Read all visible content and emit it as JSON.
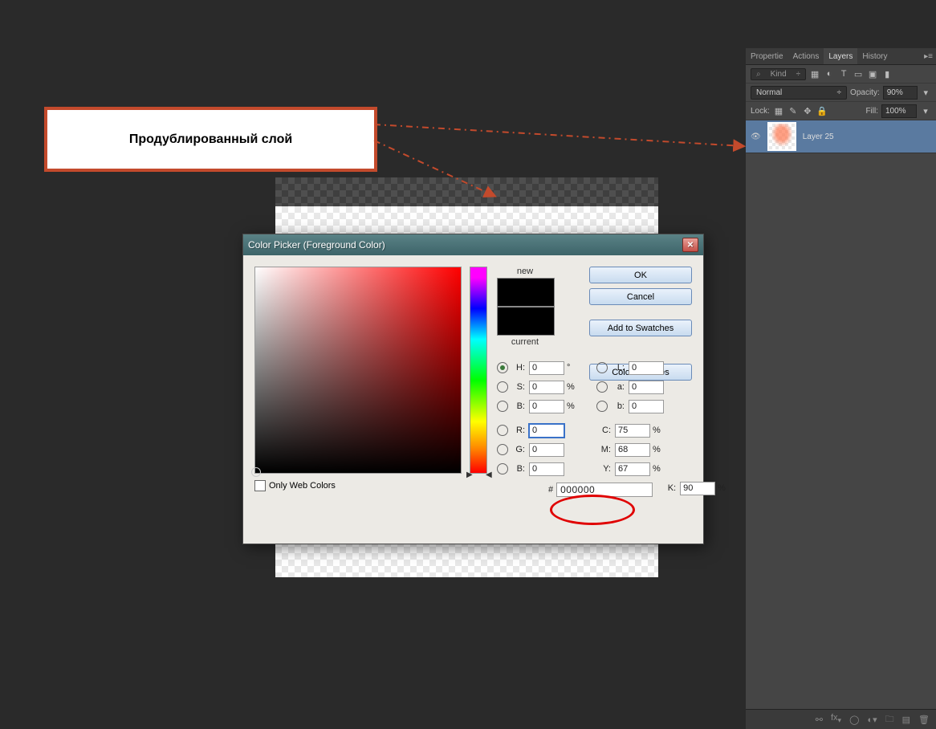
{
  "callout": {
    "text": "Продублированный слой"
  },
  "panel": {
    "tabs": [
      "Propertie",
      "Actions",
      "Layers",
      "History"
    ],
    "active_tab": "Layers",
    "kind_label": "Kind",
    "blend_mode": "Normal",
    "opacity_label": "Opacity:",
    "opacity_value": "90%",
    "lock_label": "Lock:",
    "fill_label": "Fill:",
    "fill_value": "100%",
    "layer": {
      "name": "Layer 25"
    },
    "footer_icons": [
      "link",
      "fx",
      "mask",
      "adjust",
      "group",
      "new",
      "trash"
    ]
  },
  "dialog": {
    "title": "Color Picker (Foreground Color)",
    "new_label": "new",
    "current_label": "current",
    "buttons": {
      "ok": "OK",
      "cancel": "Cancel",
      "swatches": "Add to Swatches",
      "libraries": "Color Libraries"
    },
    "hsb": {
      "H": "0",
      "S": "0",
      "B": "0",
      "H_unit": "°",
      "SB_unit": "%"
    },
    "lab": {
      "L": "0",
      "a": "0",
      "b": "0"
    },
    "rgb": {
      "R": "0",
      "G": "0",
      "B": "0"
    },
    "cmyk": {
      "C": "75",
      "M": "68",
      "Y": "67",
      "K": "90",
      "unit": "%"
    },
    "hex_label": "#",
    "hex": "000000",
    "web_colors": "Only Web Colors",
    "labels": {
      "H": "H:",
      "S": "S:",
      "B": "B:",
      "L": "L:",
      "a": "a:",
      "b2": "b:",
      "R": "R:",
      "G": "G:",
      "B2": "B:",
      "C": "C:",
      "M": "M:",
      "Y": "Y:",
      "K": "K:"
    }
  }
}
